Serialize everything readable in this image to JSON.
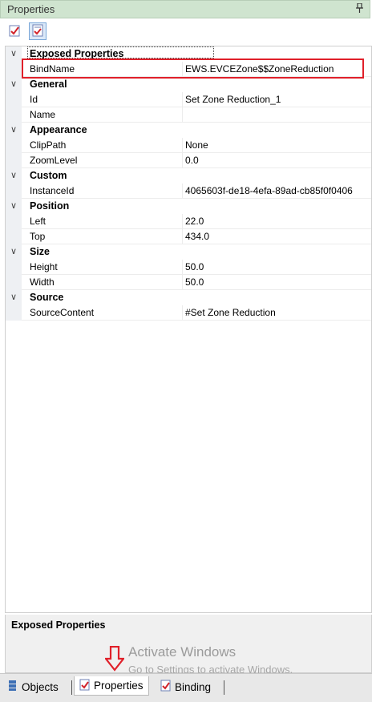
{
  "panel": {
    "title": "Properties",
    "pin_icon": "pin-icon"
  },
  "toolbar": {
    "buttons": [
      {
        "icon": "categorized-icon"
      },
      {
        "icon": "alphabetical-properties-icon"
      }
    ]
  },
  "grid": {
    "categories": [
      {
        "name": "Exposed Properties",
        "props": [
          {
            "name": "BindName",
            "value": "EWS.EVCEZone$$ZoneReduction"
          }
        ]
      },
      {
        "name": "General",
        "props": [
          {
            "name": "Id",
            "value": "Set Zone Reduction_1"
          },
          {
            "name": "Name",
            "value": ""
          }
        ]
      },
      {
        "name": "Appearance",
        "props": [
          {
            "name": "ClipPath",
            "value": "None"
          },
          {
            "name": "ZoomLevel",
            "value": "0.0"
          }
        ]
      },
      {
        "name": "Custom",
        "props": [
          {
            "name": "InstanceId",
            "value": "4065603f-de18-4efa-89ad-cb85f0f0406"
          }
        ]
      },
      {
        "name": "Position",
        "props": [
          {
            "name": "Left",
            "value": "22.0"
          },
          {
            "name": "Top",
            "value": "434.0"
          }
        ]
      },
      {
        "name": "Size",
        "props": [
          {
            "name": "Height",
            "value": "50.0"
          },
          {
            "name": "Width",
            "value": "50.0"
          }
        ]
      },
      {
        "name": "Source",
        "props": [
          {
            "name": "SourceContent",
            "value": "#Set Zone Reduction"
          }
        ]
      }
    ]
  },
  "description": {
    "title": "Exposed Properties"
  },
  "watermark": {
    "line1": "Activate Windows",
    "line2": "Go to Settings to activate Windows."
  },
  "tabs": [
    {
      "label": "Objects",
      "icon": "objects-icon"
    },
    {
      "label": "Properties",
      "icon": "properties-icon"
    },
    {
      "label": "Binding",
      "icon": "binding-icon"
    }
  ],
  "colors": {
    "highlight": "#e0202a",
    "header_bg": "#cfe4cf"
  }
}
